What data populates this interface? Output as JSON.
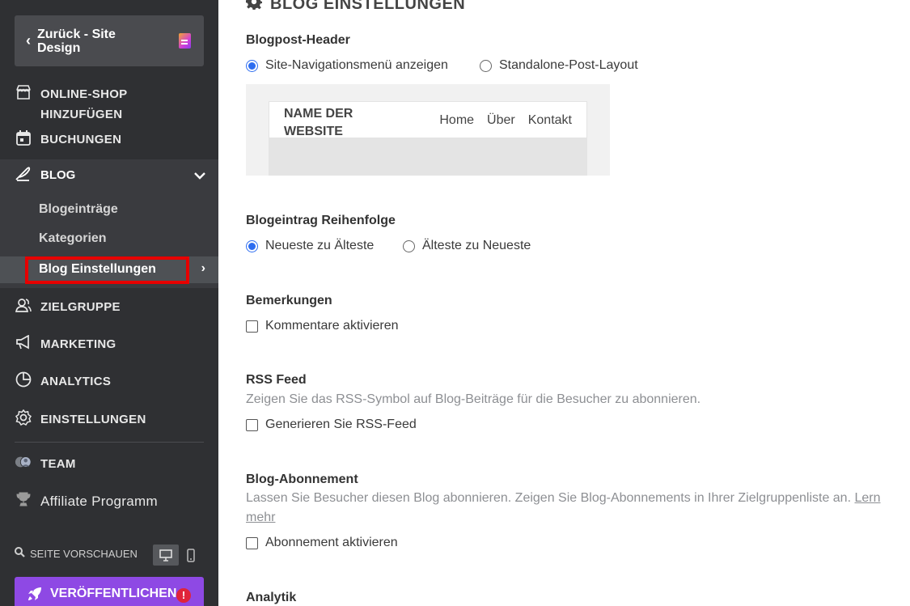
{
  "sidebar": {
    "back_label": "Zurück - Site Design",
    "nav": {
      "online_shop": "ONLINE-SHOP HINZUFÜGEN",
      "bookings": "BUCHUNGEN",
      "blog": "BLOG",
      "audience": "ZIELGRUPPE",
      "marketing": "MARKETING",
      "analytics": "ANALYTICS",
      "settings": "EINSTELLUNGEN",
      "team": "TEAM",
      "affiliate": "Affiliate Programm"
    },
    "blog_sub": [
      "Blogeinträge",
      "Kategorien",
      "Blog Einstellungen"
    ],
    "preview_label": "SEITE VORSCHAUEN",
    "publish_label": "VERÖFFENTLICHEN",
    "publish_warning": "!"
  },
  "main": {
    "title": "BLOG EINSTELLUNGEN",
    "blogpost_header": {
      "title": "Blogpost-Header",
      "options": [
        "Site-Navigationsmenü anzeigen",
        "Standalone-Post-Layout"
      ],
      "selected": 0,
      "preview": {
        "site_name": "NAME DER WEBSITE",
        "nav": [
          "Home",
          "Über",
          "Kontakt"
        ]
      }
    },
    "order": {
      "title": "Blogeintrag Reihenfolge",
      "options": [
        "Neueste zu Älteste",
        "Älteste zu Neueste"
      ],
      "selected": 0
    },
    "comments": {
      "title": "Bemerkungen",
      "checkbox": "Kommentare aktivieren",
      "checked": false
    },
    "rss": {
      "title": "RSS Feed",
      "description": "Zeigen Sie das RSS-Symbol auf Blog-Beiträge für die Besucher zu abonnieren.",
      "checkbox": "Generieren Sie RSS-Feed",
      "checked": false
    },
    "subscription": {
      "title": "Blog-Abonnement",
      "description": "Lassen Sie Besucher diesen Blog abonnieren. Zeigen Sie Blog-Abonnements in Ihrer Zielgruppenliste an.",
      "link": "Lern mehr",
      "checkbox": "Abonnement aktivieren",
      "checked": false
    },
    "analytics": {
      "title": "Analytik"
    }
  },
  "colors": {
    "sidebar_bg": "#2f3033",
    "accent_publish": "#8e49e4",
    "radio_blue": "#2d6df0",
    "highlight_red": "#e60000"
  }
}
